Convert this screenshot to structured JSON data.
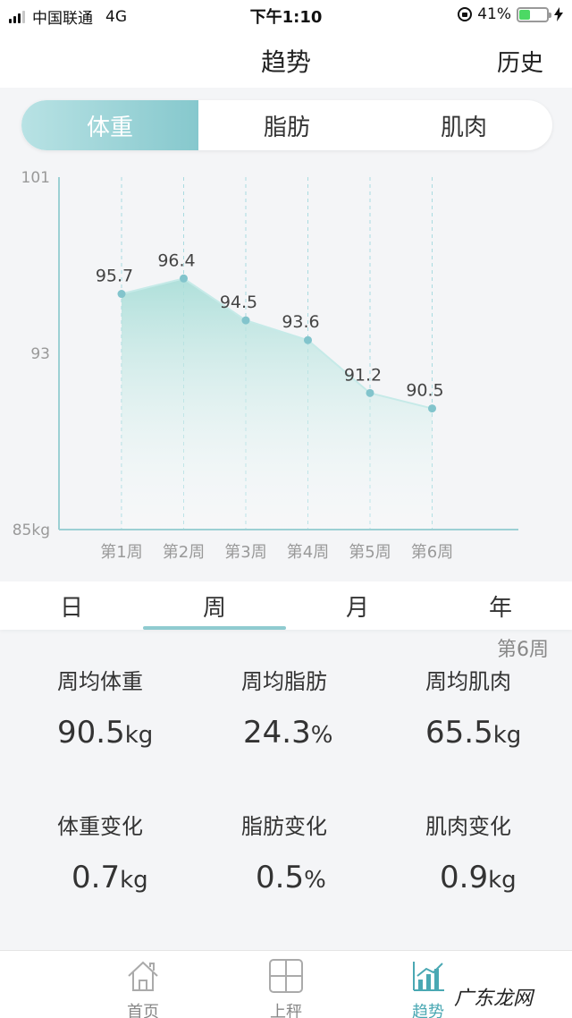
{
  "status_bar": {
    "carrier": "中国联通",
    "network": "4G",
    "time": "下午1:10",
    "battery": "41%",
    "battery_level": 0.41
  },
  "nav": {
    "title": "趋势",
    "history": "历史"
  },
  "metric_tabs": [
    {
      "label": "体重",
      "active": true
    },
    {
      "label": "脂肪",
      "active": false
    },
    {
      "label": "肌肉",
      "active": false
    }
  ],
  "chart_data": {
    "type": "area",
    "categories": [
      "第1周",
      "第2周",
      "第3周",
      "第4周",
      "第5周",
      "第6周"
    ],
    "values": [
      95.7,
      96.4,
      94.5,
      93.6,
      91.2,
      90.5
    ],
    "y_ticks": [
      "101",
      "93",
      "85kg"
    ],
    "ylim": [
      85,
      101
    ],
    "colors": {
      "line": "#c6eae8",
      "point": "#82c4cc",
      "fill_top": "#a7ddd7",
      "axis": "#9cd0d4",
      "grid": "#a9dbe0"
    }
  },
  "period_tabs": [
    {
      "label": "日",
      "active": false
    },
    {
      "label": "周",
      "active": true
    },
    {
      "label": "月",
      "active": false
    },
    {
      "label": "年",
      "active": false
    }
  ],
  "week_label": "第6周",
  "stats": {
    "avg_weight": {
      "label": "周均体重",
      "value": "90.5",
      "unit": "kg"
    },
    "avg_fat": {
      "label": "周均脂肪",
      "value": "24.3",
      "unit": "%"
    },
    "avg_muscle": {
      "label": "周均肌肉",
      "value": "65.5",
      "unit": "kg"
    },
    "weight_change": {
      "label": "体重变化",
      "value": "0.7",
      "unit": "kg"
    },
    "fat_change": {
      "label": "脂肪变化",
      "value": "0.5",
      "unit": "%"
    },
    "muscle_change": {
      "label": "肌肉变化",
      "value": "0.9",
      "unit": "kg"
    }
  },
  "tab_bar": [
    {
      "label": "首页",
      "icon": "home-icon",
      "active": false
    },
    {
      "label": "上秤",
      "icon": "scale-icon",
      "active": false
    },
    {
      "label": "趋势",
      "icon": "trend-icon",
      "active": true
    }
  ],
  "watermark": "广东龙网"
}
